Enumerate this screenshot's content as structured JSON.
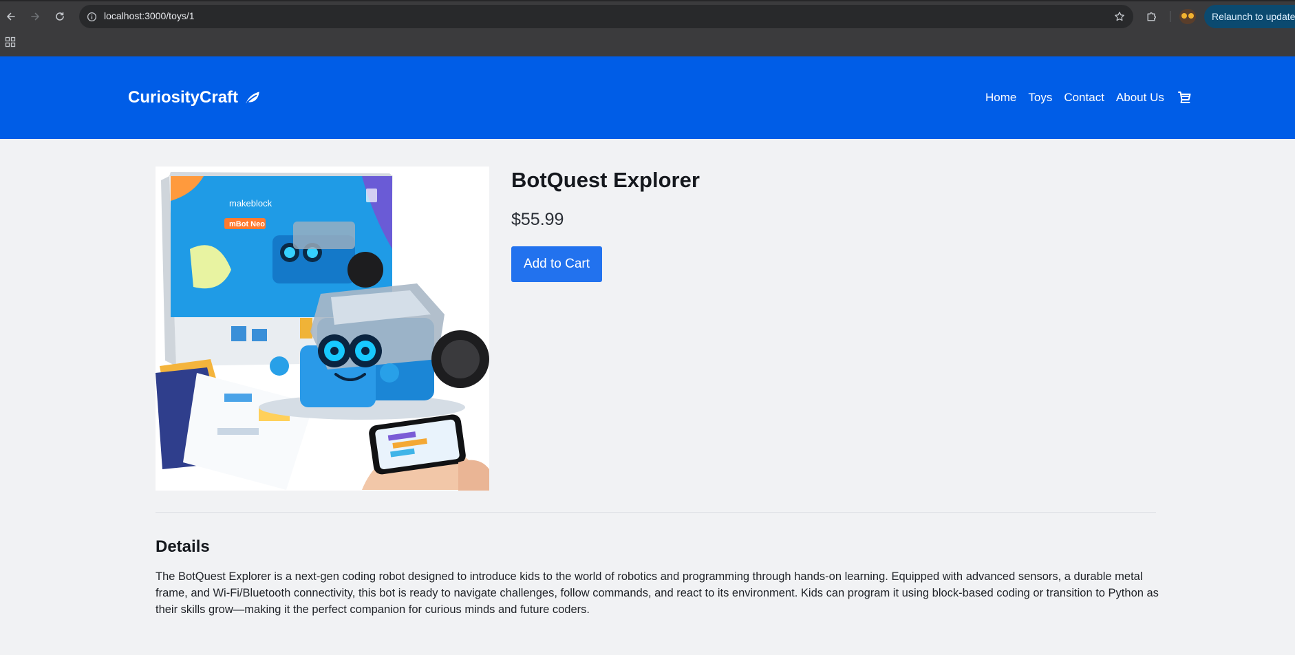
{
  "browser": {
    "url": "localhost:3000/toys/1",
    "relaunch_label": "Relaunch to update"
  },
  "site": {
    "brand": "CuriosityCraft",
    "nav": [
      "Home",
      "Toys",
      "Contact",
      "About Us"
    ],
    "header_color": "#005de7"
  },
  "product": {
    "name": "BotQuest Explorer",
    "price": "$55.99",
    "add_to_cart_label": "Add to Cart",
    "image_box_text": {
      "brand": "makeblock",
      "model": "mBot Neo"
    }
  },
  "details": {
    "heading": "Details",
    "text": "The BotQuest Explorer is a next-gen coding robot designed to introduce kids to the world of robotics and programming through hands-on learning. Equipped with advanced sensors, a durable metal frame, and Wi-Fi/Bluetooth connectivity, this bot is ready to navigate challenges, follow commands, and react to its environment. Kids can program it using block-based coding or transition to Python as their skills grow—making it the perfect companion for curious minds and future coders."
  }
}
